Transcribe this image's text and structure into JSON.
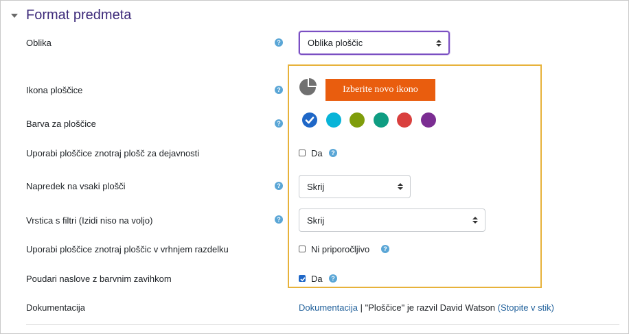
{
  "section": {
    "title": "Format predmeta"
  },
  "help_glyph": "?",
  "fields": {
    "oblika": {
      "label": "Oblika",
      "value": "Oblika ploščic"
    },
    "ikona": {
      "label": "Ikona ploščice",
      "button_label": "Izberite novo ikono",
      "icon": "pie-chart-icon"
    },
    "barva": {
      "label": "Barva za ploščice",
      "colors": [
        "#1f67c7",
        "#08b4d8",
        "#7f9d0b",
        "#0f9d82",
        "#d9403e",
        "#7b2d92"
      ],
      "selected_index": 0
    },
    "znotraj_dejavnosti": {
      "label": "Uporabi ploščice znotraj plošč za dejavnosti",
      "checkbox_label": "Da",
      "checked": false
    },
    "napredek": {
      "label": "Napredek na vsaki plošči",
      "value": "Skrij"
    },
    "vrstica_filtri": {
      "label": "Vrstica s filtri (Izidi niso na voljo)",
      "value": "Skrij"
    },
    "znotraj_ploscic": {
      "label": "Uporabi ploščice znotraj ploščic v vrhnjem razdelku",
      "checkbox_label": "Ni priporočljivo",
      "checked": false
    },
    "poudari": {
      "label": "Poudari naslove z barvnim zavihkom",
      "checkbox_label": "Da",
      "checked": true
    },
    "dokumentacija": {
      "label": "Dokumentacija",
      "link_text": "Dokumentacija",
      "separator": "|",
      "author_text": "\"Ploščice\" je razvil David Watson",
      "contact_link": "(Stopite v stik)"
    }
  }
}
